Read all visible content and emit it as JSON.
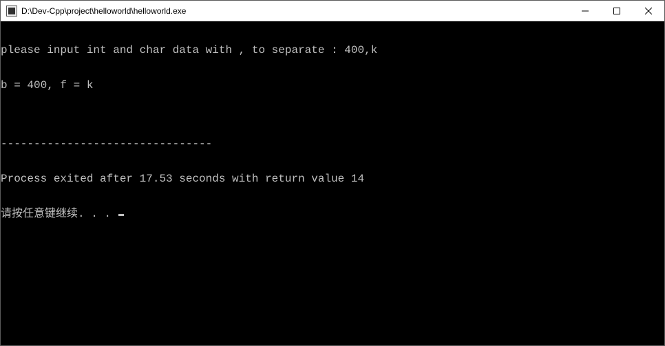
{
  "window": {
    "title": "D:\\Dev-Cpp\\project\\helloworld\\helloworld.exe"
  },
  "console": {
    "lines": [
      "please input int and char data with , to separate : 400,k",
      "b = 400, f = k",
      "",
      "--------------------------------",
      "Process exited after 17.53 seconds with return value 14",
      "请按任意键继续. . . "
    ]
  }
}
